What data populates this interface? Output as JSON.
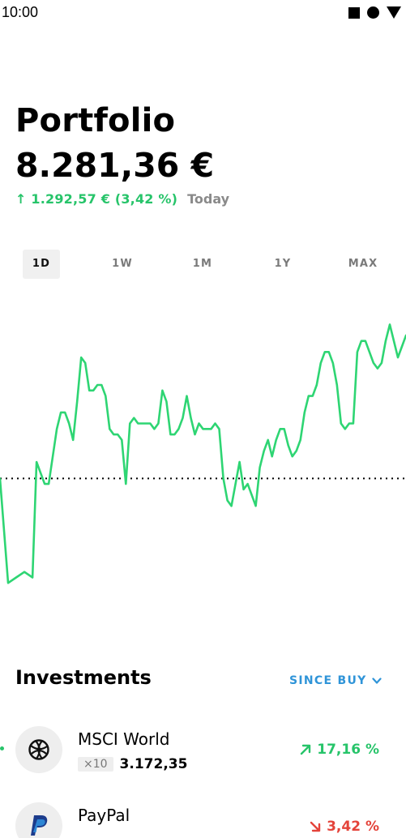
{
  "status_bar": {
    "time": "10:00"
  },
  "portfolio": {
    "title": "Portfolio",
    "value": "8.281,36 €",
    "change_arrow": "↑",
    "change": "1.292,57 € (3,42 %)",
    "period": "Today"
  },
  "range_tabs": {
    "items": [
      {
        "label": "1D"
      },
      {
        "label": "1W"
      },
      {
        "label": "1M"
      },
      {
        "label": "1Y"
      },
      {
        "label": "MAX"
      }
    ],
    "selected": "1D"
  },
  "chart_data": {
    "type": "line",
    "color": "#2ed573",
    "baseline_style": "dotted",
    "baseline_value": 8.0,
    "x": [
      0,
      2,
      4,
      6,
      8,
      9,
      10,
      11,
      12,
      13,
      14,
      15,
      16,
      17,
      18,
      19,
      20,
      21,
      22,
      23,
      24,
      25,
      26,
      27,
      28,
      29,
      30,
      31,
      32,
      33,
      34,
      35,
      36,
      37,
      38,
      39,
      40,
      41,
      42,
      43,
      44,
      45,
      46,
      47,
      48,
      49,
      50,
      51,
      52,
      53,
      54,
      55,
      56,
      57,
      58,
      59,
      60,
      61,
      62,
      63,
      64,
      65,
      66,
      67,
      68,
      69,
      70,
      71,
      72,
      73,
      74,
      75,
      76,
      77,
      78,
      79,
      80,
      81,
      82,
      83,
      84,
      85,
      86,
      87,
      88,
      89,
      90,
      91,
      92,
      93,
      94,
      95,
      96,
      97,
      98,
      99,
      100
    ],
    "y": [
      8.0,
      6.1,
      6.2,
      6.3,
      6.2,
      8.3,
      8.1,
      7.9,
      7.9,
      8.4,
      8.9,
      9.2,
      9.2,
      9.0,
      8.7,
      9.4,
      10.2,
      10.1,
      9.6,
      9.6,
      9.7,
      9.7,
      9.5,
      8.9,
      8.8,
      8.8,
      8.7,
      7.9,
      9.0,
      9.1,
      9.0,
      9.0,
      9.0,
      9.0,
      8.9,
      9.0,
      9.6,
      9.4,
      8.8,
      8.8,
      8.9,
      9.1,
      9.5,
      9.1,
      8.8,
      9.0,
      8.9,
      8.9,
      8.9,
      9.0,
      8.9,
      8.0,
      7.6,
      7.5,
      7.9,
      8.3,
      7.8,
      7.9,
      7.7,
      7.5,
      8.2,
      8.5,
      8.7,
      8.4,
      8.7,
      8.9,
      8.9,
      8.6,
      8.4,
      8.5,
      8.7,
      9.2,
      9.5,
      9.5,
      9.7,
      10.1,
      10.3,
      10.3,
      10.1,
      9.7,
      9.0,
      8.9,
      9.0,
      9.0,
      10.3,
      10.5,
      10.5,
      10.3,
      10.1,
      10.0,
      10.1,
      10.5,
      10.8,
      10.5,
      10.2,
      10.4,
      10.6
    ]
  },
  "investments": {
    "title": "Investments",
    "sort_label": "SINCE BUY",
    "items": [
      {
        "name": "MSCI World",
        "quantity": "×10",
        "price": "3.172,35",
        "performance": "17,16 %",
        "direction": "up",
        "icon": "globe-icon"
      },
      {
        "name": "PayPal",
        "quantity": "",
        "price": "",
        "performance": "3,42 %",
        "direction": "down",
        "icon": "paypal-logo"
      }
    ]
  }
}
